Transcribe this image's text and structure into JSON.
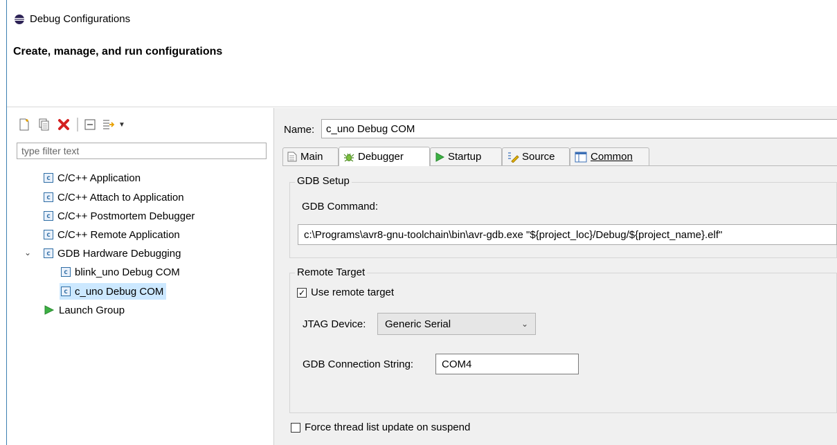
{
  "window": {
    "title": "Debug Configurations"
  },
  "header": {
    "message": "Create, manage, and run configurations"
  },
  "toolbar": {
    "icons": [
      "new-config-icon",
      "duplicate-icon",
      "delete-icon",
      "collapse-all-icon",
      "filter-icon",
      "dropdown-icon"
    ]
  },
  "filter": {
    "placeholder": "type filter text"
  },
  "tree": {
    "items": [
      {
        "label": "C/C++ Application"
      },
      {
        "label": "C/C++ Attach to Application"
      },
      {
        "label": "C/C++ Postmortem Debugger"
      },
      {
        "label": "C/C++ Remote Application"
      },
      {
        "label": "GDB Hardware Debugging"
      },
      {
        "label": "blink_uno Debug COM"
      },
      {
        "label": "c_uno Debug COM"
      },
      {
        "label": "Launch Group"
      }
    ]
  },
  "config": {
    "name_label": "Name:",
    "name_value": "c_uno Debug COM",
    "tabs": [
      {
        "label": "Main"
      },
      {
        "label": "Debugger"
      },
      {
        "label": "Startup"
      },
      {
        "label": "Source"
      },
      {
        "label": "Common"
      }
    ],
    "active_tab": "Debugger",
    "gdb_setup": {
      "title": "GDB Setup",
      "command_label": "GDB Command:",
      "command_value": "c:\\Programs\\avr8-gnu-toolchain\\bin\\avr-gdb.exe \"${project_loc}/Debug/${project_name}.elf\""
    },
    "remote_target": {
      "title": "Remote Target",
      "use_remote_label": "Use remote target",
      "use_remote_checked": true,
      "jtag_label": "JTAG Device:",
      "jtag_value": "Generic Serial",
      "conn_label": "GDB Connection String:",
      "conn_value": "COM4"
    },
    "force_thread_label": "Force thread list update on suspend",
    "force_thread_checked": false
  }
}
